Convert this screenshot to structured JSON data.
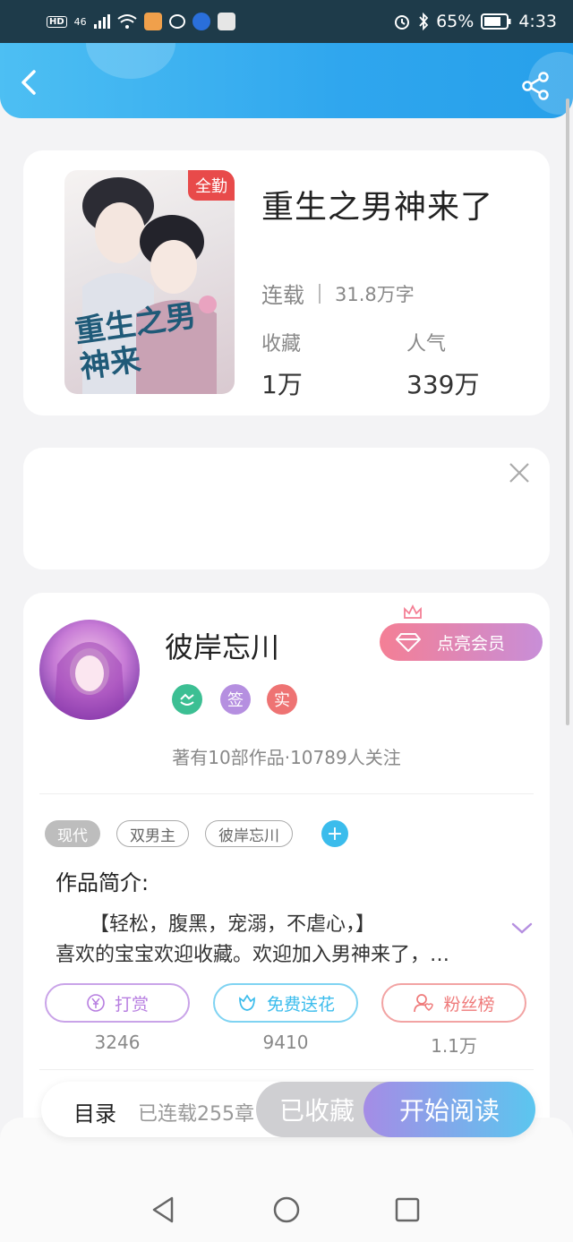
{
  "status_bar": {
    "hd": "HD",
    "signal": "46",
    "battery": "65%",
    "time": "4:33"
  },
  "header": {
    "back_icon": "back-arrow-icon",
    "share_icon": "share-icon"
  },
  "book": {
    "cover_badge": "全勤",
    "cover_art_text": "重生之男神来",
    "title": "重生之男神来了",
    "status": "连载",
    "word_count": "31.8万字",
    "favorites_label": "收藏",
    "favorites_value": "1万",
    "popularity_label": "人气",
    "popularity_value": "339万"
  },
  "ad": {
    "close_icon": "close-icon"
  },
  "author": {
    "name": "彼岸忘川",
    "badges": [
      "",
      "签",
      "实"
    ],
    "vip_label": "点亮会员",
    "meta": "著有10部作品·10789人关注"
  },
  "tags": [
    "现代",
    "双男主",
    "彼岸忘川"
  ],
  "intro": {
    "heading": "作品简介:",
    "line1": "【轻松，腹黑，宠溺，不虐心，】",
    "line2": "喜欢的宝宝欢迎收藏。欢迎加入男神来了，…"
  },
  "actions": [
    {
      "label": "打赏",
      "count": "3246",
      "color": "#b77ee0",
      "icon": "yen-icon"
    },
    {
      "label": "免费送花",
      "count": "9410",
      "color": "#3bbcec",
      "icon": "flower-icon"
    },
    {
      "label": "粉丝榜",
      "count": "1.1万",
      "color": "#ef7a7a",
      "icon": "fan-icon"
    }
  ],
  "bottom": {
    "toc": "目录",
    "toc_status": "已连载255章",
    "favorited": "已收藏",
    "start_reading": "开始阅读"
  },
  "colors": {
    "header_gradient_start": "#4dbff3",
    "header_gradient_end": "#27a0ea",
    "vip_start": "#f47f95",
    "vip_end": "#c88ed8",
    "read_start": "#a58ce6",
    "read_end": "#5bc6ef"
  }
}
